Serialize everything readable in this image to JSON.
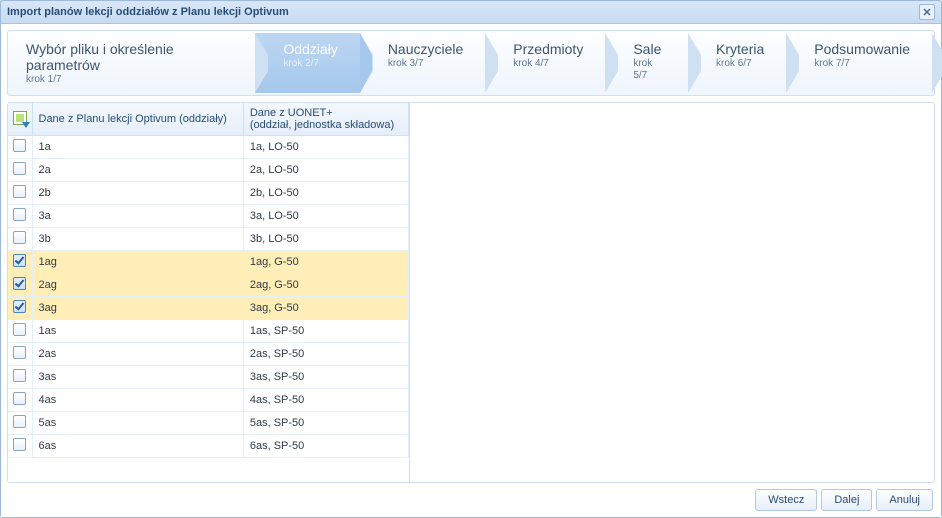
{
  "window_title": "Import planów lekcji oddziałów z Planu lekcji Optivum",
  "wizard": {
    "steps": [
      {
        "title": "Wybór pliku i określenie parametrów",
        "sub": "krok 1/7",
        "active": false
      },
      {
        "title": "Oddziały",
        "sub": "krok 2/7",
        "active": true
      },
      {
        "title": "Nauczyciele",
        "sub": "krok 3/7",
        "active": false
      },
      {
        "title": "Przedmioty",
        "sub": "krok 4/7",
        "active": false
      },
      {
        "title": "Sale",
        "sub": "krok 5/7",
        "active": false
      },
      {
        "title": "Kryteria",
        "sub": "krok 6/7",
        "active": false
      },
      {
        "title": "Podsumowanie",
        "sub": "krok 7/7",
        "active": false
      }
    ]
  },
  "table": {
    "header_col1": "Dane z Planu lekcji Optivum (oddziały)",
    "header_col2": "Dane z UONET+\n(oddział, jednostka składowa)",
    "rows": [
      {
        "checked": false,
        "c1": "1a",
        "c2": "1a, LO-50"
      },
      {
        "checked": false,
        "c1": "2a",
        "c2": "2a, LO-50"
      },
      {
        "checked": false,
        "c1": "2b",
        "c2": "2b, LO-50"
      },
      {
        "checked": false,
        "c1": "3a",
        "c2": "3a, LO-50"
      },
      {
        "checked": false,
        "c1": "3b",
        "c2": "3b, LO-50"
      },
      {
        "checked": true,
        "c1": "1ag",
        "c2": "1ag, G-50"
      },
      {
        "checked": true,
        "c1": "2ag",
        "c2": "2ag, G-50"
      },
      {
        "checked": true,
        "c1": "3ag",
        "c2": "3ag, G-50"
      },
      {
        "checked": false,
        "c1": "1as",
        "c2": "1as, SP-50"
      },
      {
        "checked": false,
        "c1": "2as",
        "c2": "2as, SP-50"
      },
      {
        "checked": false,
        "c1": "3as",
        "c2": "3as, SP-50"
      },
      {
        "checked": false,
        "c1": "4as",
        "c2": "4as, SP-50"
      },
      {
        "checked": false,
        "c1": "5as",
        "c2": "5as, SP-50"
      },
      {
        "checked": false,
        "c1": "6as",
        "c2": "6as, SP-50"
      }
    ]
  },
  "footer": {
    "back": "Wstecz",
    "next": "Dalej",
    "cancel": "Anuluj"
  }
}
